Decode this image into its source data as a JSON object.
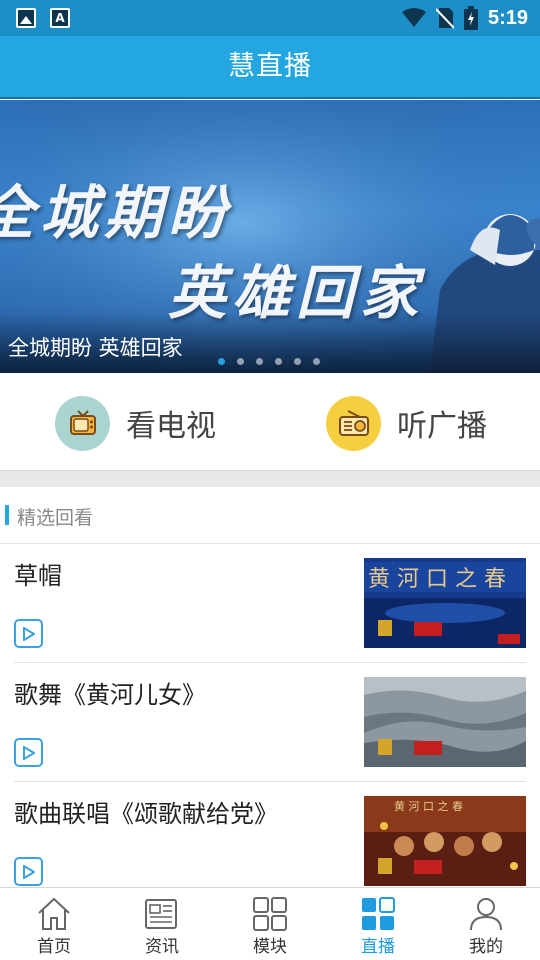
{
  "status_bar": {
    "time": "5:19",
    "icons": [
      "image-notification-icon",
      "font-notification-icon",
      "wifi-icon",
      "no-sim-icon",
      "battery-icon"
    ]
  },
  "header": {
    "title": "慧直播"
  },
  "banner": {
    "caption": "全城期盼 英雄回家",
    "artwork_text_line1": "全城期盼",
    "artwork_text_line2": "英雄回家",
    "dots_total": 6,
    "active_dot": 1
  },
  "quick_entries": [
    {
      "label": "看电视",
      "icon": "tv-icon",
      "color": "#a9d4d0"
    },
    {
      "label": "听广播",
      "icon": "radio-icon",
      "color": "#f5cf3f"
    }
  ],
  "section": {
    "title": "精选回看"
  },
  "list": [
    {
      "title": "草帽",
      "thumb": "yellow-river-spring-stage"
    },
    {
      "title": "歌舞《黄河儿女》",
      "thumb": "river-waves"
    },
    {
      "title": "歌曲联唱《颂歌献给党》",
      "thumb": "red-stage-performance"
    }
  ],
  "tabbar": {
    "items": [
      {
        "label": "首页",
        "icon": "home-icon"
      },
      {
        "label": "资讯",
        "icon": "news-icon"
      },
      {
        "label": "模块",
        "icon": "modules-icon"
      },
      {
        "label": "直播",
        "icon": "live-icon"
      },
      {
        "label": "我的",
        "icon": "profile-icon"
      }
    ],
    "active_index": 3
  },
  "colors": {
    "brand": "#24a7e0",
    "status_bar": "#1d8fc8",
    "active_tab": "#1f9be0"
  }
}
